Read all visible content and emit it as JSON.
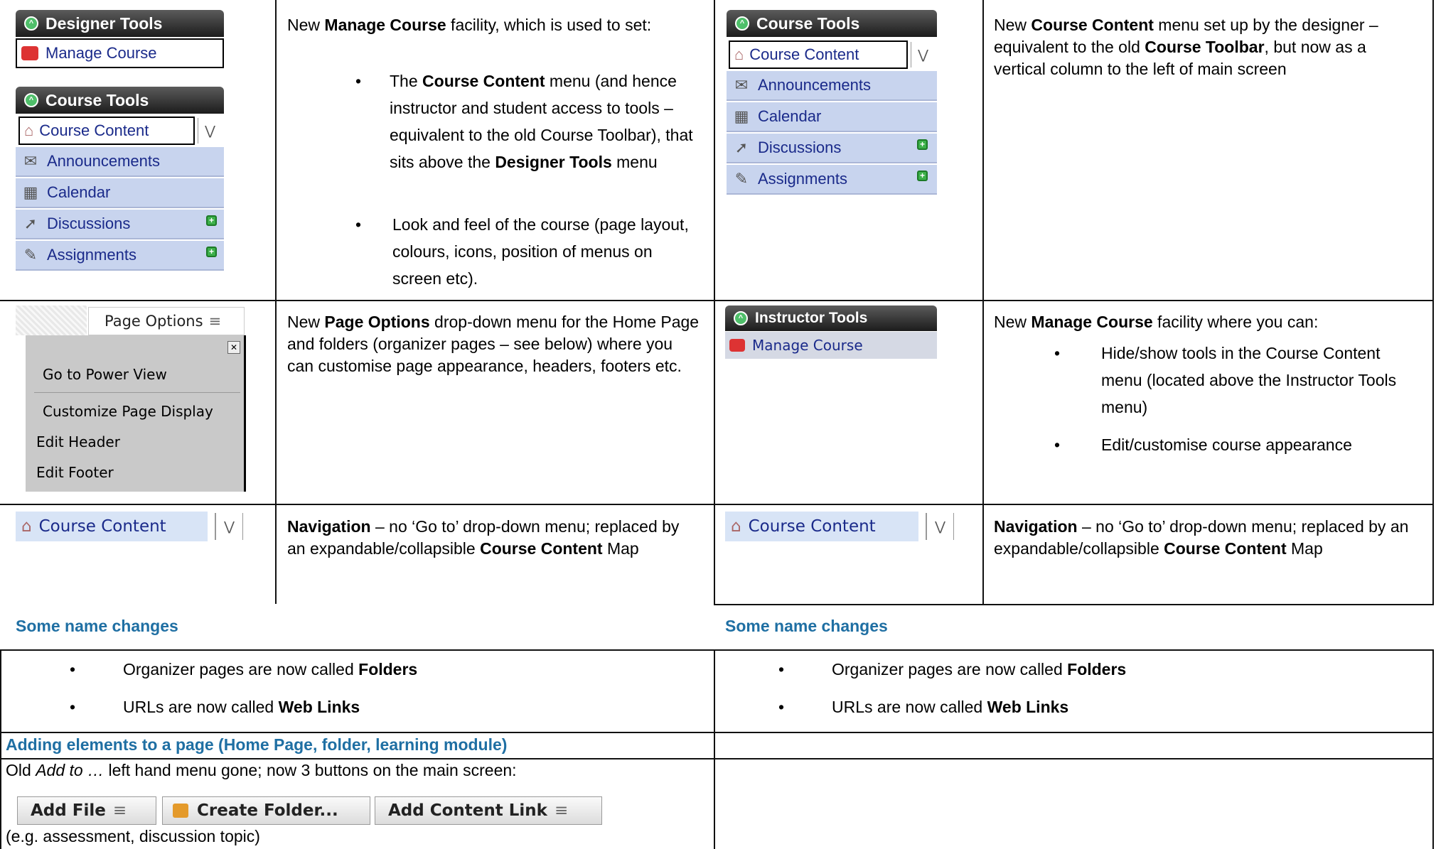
{
  "row1": {
    "left_widget": {
      "designer_header": "Designer Tools",
      "designer_item": "Manage Course",
      "course_tools_header": "Course Tools",
      "items": [
        {
          "label": "Course Content",
          "icon": "home-icon"
        },
        {
          "label": "Announcements",
          "icon": "megaphone-icon"
        },
        {
          "label": "Calendar",
          "icon": "calendar-icon"
        },
        {
          "label": "Discussions",
          "icon": "pin-icon"
        },
        {
          "label": "Assignments",
          "icon": "assignment-icon"
        }
      ]
    },
    "left_text": {
      "intro_pre": "New ",
      "intro_bold": "Manage Course",
      "intro_post": " facility, which is used to set:",
      "b1_pre": "The ",
      "b1_bold1": "Course Content",
      "b1_mid": " menu (and hence instructor and student access to tools – equivalent to the old Course Toolbar), that sits above the ",
      "b1_bold2": "Designer Tools",
      "b1_post": " menu",
      "b2": "Look and feel of the course (page layout, colours, icons, position of menus on screen etc)."
    },
    "right_widget": {
      "course_tools_header": "Course Tools",
      "items": [
        {
          "label": "Course Content",
          "icon": "home-icon"
        },
        {
          "label": "Announcements",
          "icon": "megaphone-icon"
        },
        {
          "label": "Calendar",
          "icon": "calendar-icon"
        },
        {
          "label": "Discussions",
          "icon": "pin-icon"
        },
        {
          "label": "Assignments",
          "icon": "assignment-icon"
        }
      ]
    },
    "right_text": {
      "pre": "New ",
      "bold1": "Course Content",
      "mid": " menu set up by the designer – equivalent to the old ",
      "bold2": "Course Toolbar",
      "post": ", but now as a vertical column to the left of main screen"
    }
  },
  "row2": {
    "page_options": {
      "button": "Page Options",
      "close": "✕",
      "items": [
        "Go to Power View",
        "Customize Page Display",
        "Edit Header",
        "Edit Footer"
      ]
    },
    "left_text": {
      "pre": "New ",
      "bold": "Page Options",
      "post": " drop-down menu for the Home Page and folders (organizer pages – see below) where you can customise page appearance, headers, footers etc."
    },
    "instructor_widget": {
      "header": "Instructor Tools",
      "item": "Manage Course"
    },
    "right_text": {
      "pre": "New ",
      "bold": "Manage Course",
      "post": " facility where you can:",
      "b1": "Hide/show tools in the Course Content menu (located above the Instructor Tools menu)",
      "b2": "Edit/customise course appearance"
    }
  },
  "row3": {
    "selector": "Course Content",
    "nav_bold1": "Navigation",
    "nav_mid": " – no ‘Go to’ drop-down menu; replaced by an expandable/collapsible ",
    "nav_bold2": "Course Content",
    "nav_post": " Map"
  },
  "name_changes": {
    "heading": "Some name changes",
    "b1_pre": "Organizer pages are now called ",
    "b1_bold": "Folders",
    "b2_pre": "URLs are now called ",
    "b2_bold": "Web Links"
  },
  "adding": {
    "heading": "Adding elements to a page (Home Page, folder, learning module)",
    "line_pre": "Old ",
    "line_italic": "Add to …",
    "line_post": " left hand menu gone; now 3 buttons on the main screen:",
    "buttons": [
      "Add File",
      "Create Folder...",
      "Add Content Link"
    ],
    "note": "(e.g. assessment, discussion topic)"
  },
  "colors": {
    "heading_blue": "#1f6fa3",
    "menu_item_bg": "#c8d4ee",
    "menu_text": "#1a2a8a"
  }
}
